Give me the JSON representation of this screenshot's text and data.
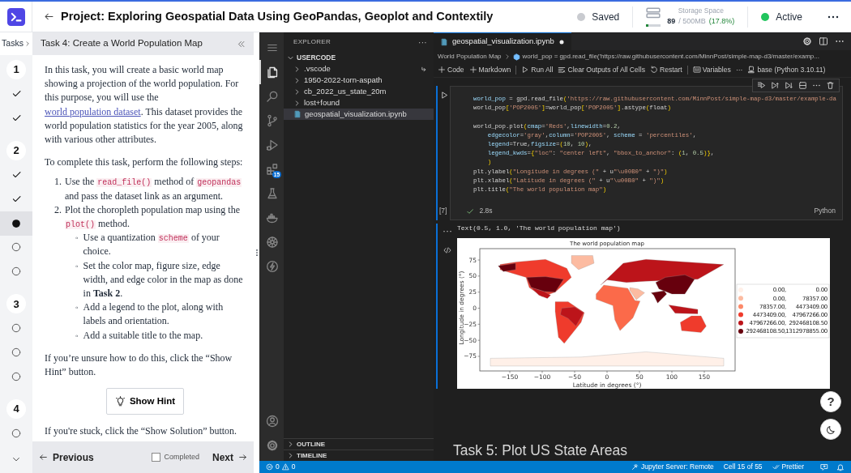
{
  "header": {
    "title": "Project: Exploring Geospatial Data Using GeoPandas, Geoplot and Contextily",
    "save_status": "Saved",
    "storage": {
      "label": "Storage Space",
      "used": "89",
      "total": "/ 500MB",
      "percent": "(17.8%)",
      "level": 0.178
    },
    "session_status": "Active"
  },
  "rail": {
    "label": "Tasks",
    "steps": [
      {
        "kind": "number",
        "text": "1",
        "selected": false
      },
      {
        "kind": "done",
        "selected": false
      },
      {
        "kind": "done",
        "selected": false
      },
      {
        "kind": "number",
        "text": "2",
        "selected": false
      },
      {
        "kind": "done",
        "selected": false
      },
      {
        "kind": "done",
        "selected": false
      },
      {
        "kind": "current",
        "selected": true
      },
      {
        "kind": "todo",
        "selected": false
      },
      {
        "kind": "todo",
        "selected": false
      },
      {
        "kind": "number",
        "text": "3",
        "selected": false
      },
      {
        "kind": "todo",
        "selected": false
      },
      {
        "kind": "todo",
        "selected": false
      },
      {
        "kind": "todo",
        "selected": false
      },
      {
        "kind": "number",
        "text": "4",
        "selected": false
      },
      {
        "kind": "todo",
        "selected": false
      }
    ]
  },
  "task": {
    "title": "Task 4: Create a World Population Map",
    "blocks": [
      {
        "kind": "paragraph",
        "parts": [
          {
            "kind": "text",
            "text": "In this task, you will create a basic world map showing a projection of the world population. For this purpose, you will use the "
          },
          {
            "kind": "link",
            "text": "world population dataset"
          },
          {
            "kind": "text",
            "text": ". This dataset provides the world population statistics for the year 2005, along with various other attributes."
          }
        ]
      },
      {
        "kind": "paragraph",
        "parts": [
          {
            "kind": "text",
            "text": "To complete this task, perform the following steps:"
          }
        ]
      },
      {
        "kind": "steps",
        "items": [
          {
            "marker": "1.",
            "parts": [
              {
                "kind": "text",
                "text": "Use the "
              },
              {
                "kind": "code",
                "text": "read_file()"
              },
              {
                "kind": "text",
                "text": " method of "
              },
              {
                "kind": "code",
                "text": "geopandas"
              },
              {
                "kind": "text",
                "text": " and pass the dataset link as an argument."
              }
            ]
          },
          {
            "marker": "2.",
            "parts": [
              {
                "kind": "text",
                "text": "Plot the choropleth population map using the "
              },
              {
                "kind": "code",
                "text": "plot()"
              },
              {
                "kind": "text",
                "text": " method."
              }
            ],
            "children": [
              {
                "marker": "◦",
                "parts": [
                  {
                    "kind": "text",
                    "text": "Use a quantization "
                  },
                  {
                    "kind": "code",
                    "text": "scheme"
                  },
                  {
                    "kind": "text",
                    "text": " of your choice."
                  }
                ]
              },
              {
                "marker": "◦",
                "parts": [
                  {
                    "kind": "text",
                    "text": "Set the color map, figure size, edge width, and edge color in the map as done in "
                  },
                  {
                    "kind": "bold",
                    "text": "Task 2"
                  },
                  {
                    "kind": "text",
                    "text": "."
                  }
                ]
              },
              {
                "marker": "◦",
                "parts": [
                  {
                    "kind": "text",
                    "text": "Add a legend to the plot, along with labels and orientation."
                  }
                ]
              },
              {
                "marker": "◦",
                "parts": [
                  {
                    "kind": "text",
                    "text": "Add a suitable title to the map."
                  }
                ]
              }
            ]
          }
        ]
      },
      {
        "kind": "paragraph",
        "parts": [
          {
            "kind": "text",
            "text": "If you’re unsure how to do this, click the “Show Hint” button."
          }
        ]
      },
      {
        "kind": "button",
        "label": "Show Hint"
      },
      {
        "kind": "paragraph",
        "parts": [
          {
            "kind": "text",
            "text": "If you're stuck, click the “Show Solution” button."
          }
        ]
      }
    ],
    "previous": "Previous",
    "completed": {
      "label": "Completed",
      "checked": false
    },
    "next": "Next"
  },
  "activity_bar": {
    "items": [
      {
        "selected": true
      },
      {
        "selected": false
      },
      {
        "selected": false
      },
      {
        "selected": false
      },
      {
        "selected": false,
        "badge": "15"
      },
      {
        "selected": false
      },
      {
        "selected": false
      },
      {
        "selected": false
      },
      {
        "selected": false
      }
    ]
  },
  "explorer": {
    "title": "EXPLORER",
    "more": "···",
    "root": "USERCODE",
    "items": [
      {
        "kind": "folder",
        "name": ".vscode",
        "selected": false
      },
      {
        "kind": "folder",
        "name": "1950-2022-torn-aspath",
        "selected": false
      },
      {
        "kind": "folder",
        "name": "cb_2022_us_state_20m",
        "selected": false
      },
      {
        "kind": "folder",
        "name": "lost+found",
        "selected": false
      },
      {
        "kind": "file",
        "name": "geospatial_visualization.ipynb",
        "selected": true
      }
    ],
    "sections": [
      "OUTLINE",
      "TIMELINE"
    ]
  },
  "editor": {
    "tab": {
      "label": "geospatial_visualization.ipynb",
      "modified": true
    },
    "breadcrumb": [
      "World Population Map",
      "world_pop = gpd.read_file('https://raw.githubusercontent.com/MinnPost/simple-map-d3/master/examp..."
    ],
    "toolbar": [
      "Code",
      "Markdown",
      "Run All",
      "Clear Outputs of All Cells",
      "Restart",
      "Variables",
      "···"
    ],
    "kernel": "base (Python 3.10.11)",
    "cell": {
      "lines": [
        {
          "kind": "code",
          "text": "world_pop = gpd.read_file('https://raw.githubusercontent.com/MinnPost/simple-map-d3/master/example-da"
        },
        {
          "kind": "code",
          "text": "world_pop['POP2005']=world_pop['POP2005'].astype(float)"
        },
        {
          "kind": "blank"
        },
        {
          "kind": "code",
          "text": "world_pop.plot(cmap='Reds',linewidth=0.2,"
        },
        {
          "kind": "code",
          "text": "    edgecolor='gray',column='POP2005', scheme = 'percentiles',"
        },
        {
          "kind": "code",
          "text": "    legend=True,figsize=(10, 10),"
        },
        {
          "kind": "code",
          "text": "    legend_kwds={\"loc\": \"center left\", \"bbox_to_anchor\": (1, 0.5)},"
        },
        {
          "kind": "code",
          "text": "    )"
        },
        {
          "kind": "code",
          "text": "plt.ylabel(\"Longitude in degrees (\" + u\"\\u00B0\" + \")\")"
        },
        {
          "kind": "code",
          "text": "plt.xlabel(\"Latitude in degrees (\" + u\"\\u00B0\" + \")\")"
        },
        {
          "kind": "code",
          "text": "plt.title(\"The world population map\")"
        }
      ],
      "count": "[7]",
      "duration": "2.8s",
      "language": "Python",
      "output_more": "···",
      "output_text": "Text(0.5, 1.0, 'The world population map')"
    },
    "figure": {
      "title": "The world population map",
      "xlabel": "Latitude in degrees (°)",
      "ylabel": "Longitude in degrees (°)",
      "xticks": [
        "−150",
        "−100",
        "−50",
        "0",
        "50",
        "100",
        "150"
      ],
      "yticks": [
        "75",
        "50",
        "25",
        "0",
        "−25",
        "−50",
        "−75"
      ],
      "legend": [
        {
          "low": "0.00,",
          "high": "0.00",
          "color": "#fff0e8"
        },
        {
          "low": "0.00,",
          "high": "78357.00",
          "color": "#fcbba1"
        },
        {
          "low": "78357.00,",
          "high": "4473409.00",
          "color": "#fc8a6a"
        },
        {
          "low": "4473409.00,",
          "high": "47967266.00",
          "color": "#ef3b2c"
        },
        {
          "low": "47967266.00,",
          "high": "292468108.50",
          "color": "#bc141a"
        },
        {
          "low": "292468108.50,",
          "high": "1312978855.00",
          "color": "#67000d"
        }
      ]
    },
    "next_heading": "Task 5: Plot US State Areas"
  },
  "help_button": "?",
  "status_bar": {
    "errors": "0",
    "warnings": "0",
    "server": "Jupyter Server: Remote",
    "cell": "Cell 15 of 55",
    "formatter": "Prettier"
  }
}
